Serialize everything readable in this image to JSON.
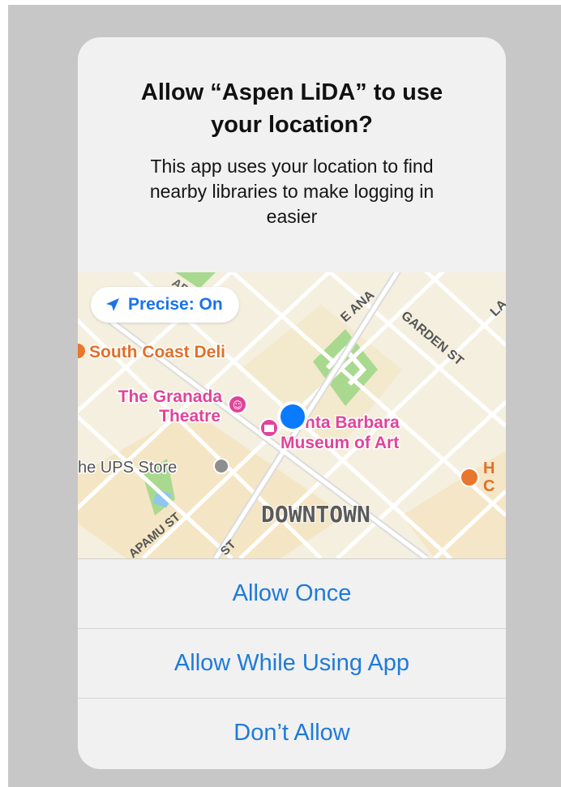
{
  "dialog": {
    "title_line1": "Allow “Aspen LiDA” to use",
    "title_line2": "your location?",
    "message_line1": "This app uses your location to find",
    "message_line2": "nearby libraries to make logging in",
    "message_line3": "easier"
  },
  "map": {
    "precise_label": "Precise: On",
    "places": {
      "deli": "South Coast Deli",
      "theatre_line1": "The Granada",
      "theatre_line2": "Theatre",
      "museum_line1": "nta Barbara",
      "museum_line2": "Museum of Art",
      "ups": "he UPS Store",
      "cafe_line1": "H",
      "cafe_line2": "C"
    },
    "district": "DOWNTOWN",
    "streets": {
      "anapamu": "E ANA",
      "garden": "GARDEN ST",
      "top_left": "AP",
      "top_right": "LA",
      "bottom_left": "APAMU ST",
      "bottom_mid": "ST"
    },
    "colors": {
      "poi_orange": "#e8762d",
      "poi_pink": "#e0449a",
      "user_dot": "#0a7aff",
      "park": "#9fd18b"
    }
  },
  "buttons": {
    "allow_once": "Allow Once",
    "allow_while_using": "Allow While Using App",
    "dont_allow": "Don’t Allow"
  },
  "accent_color": "#1e7bd9"
}
